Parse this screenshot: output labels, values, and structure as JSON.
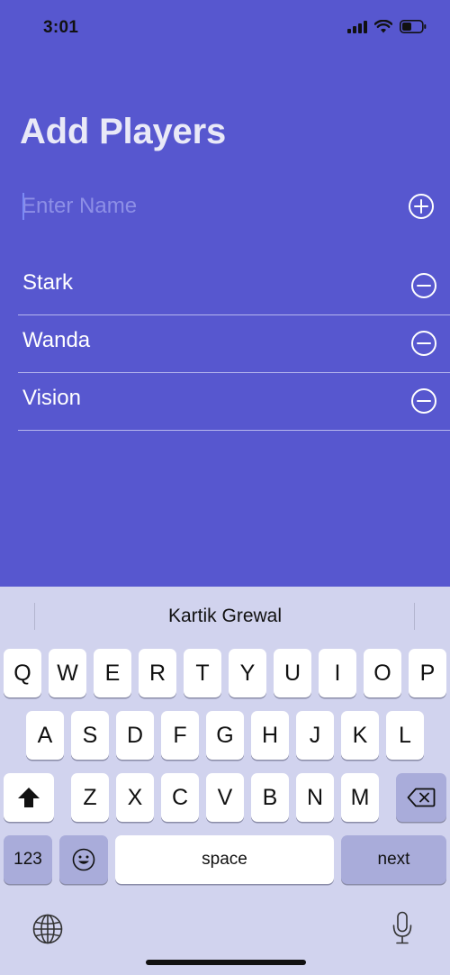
{
  "status": {
    "time": "3:01"
  },
  "title": "Add Players",
  "input": {
    "placeholder": "Enter Name",
    "value": ""
  },
  "players": [
    "Stark",
    "Wanda",
    "Vision"
  ],
  "keyboard": {
    "suggestion": "Kartik Grewal",
    "row1": [
      "Q",
      "W",
      "E",
      "R",
      "T",
      "Y",
      "U",
      "I",
      "O",
      "P"
    ],
    "row2": [
      "A",
      "S",
      "D",
      "F",
      "G",
      "H",
      "J",
      "K",
      "L"
    ],
    "row3": [
      "Z",
      "X",
      "C",
      "V",
      "B",
      "N",
      "M"
    ],
    "numbers_label": "123",
    "space_label": "space",
    "next_label": "next"
  },
  "colors": {
    "background": "#5757cf",
    "keyboard": "#d1d3ee",
    "title": "#e9e9f7"
  },
  "icons": {
    "signal": "signal-icon",
    "wifi": "wifi-icon",
    "battery": "battery-icon",
    "add": "plus-circle-icon",
    "remove": "minus-circle-icon",
    "shift": "shift-icon",
    "delete": "backspace-icon",
    "emoji": "emoji-icon",
    "globe": "globe-icon",
    "mic": "microphone-icon"
  }
}
